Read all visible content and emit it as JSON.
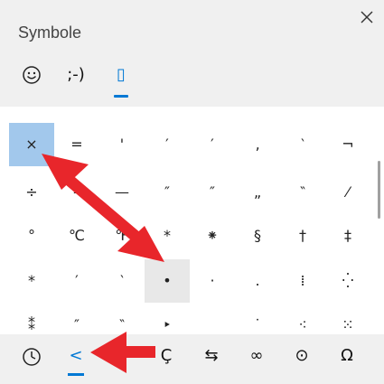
{
  "panel": {
    "title": "Symbole",
    "close_glyph": "✕"
  },
  "tabs": [
    {
      "label": "☺",
      "icon": "emoji-icon"
    },
    {
      "label": ";-)",
      "icon": "kaomoji-icon"
    },
    {
      "label": "▯",
      "icon": "symbols-icon",
      "active": true
    }
  ],
  "grid": {
    "partial_top_row": [
      "(",
      "",
      ""
    ],
    "rows": [
      [
        "×",
        "=",
        "'",
        "′",
        "′",
        "‚",
        "‵",
        "¬"
      ],
      [
        "÷",
        "–",
        "—",
        "″",
        "″",
        "„",
        "‶",
        "⁄"
      ],
      [
        "°",
        "℃",
        "℉",
        "*",
        "⁕",
        "§",
        "†",
        "‡"
      ],
      [
        "*",
        "′",
        "‵",
        "•",
        "·",
        ".",
        "⁞",
        "⁛"
      ],
      [
        "⁑",
        "″",
        "‶",
        "‣",
        "",
        "˙",
        "⁖",
        "⁙"
      ]
    ],
    "selected": "×",
    "hovered": "•"
  },
  "bottom_tabs": [
    {
      "label": "🕓",
      "icon": "recent-icon"
    },
    {
      "label": "<",
      "icon": "punctuation-icon",
      "active": true
    },
    {
      "label": "$",
      "icon": "currency-icon"
    },
    {
      "label": "Ç",
      "icon": "latin-icon"
    },
    {
      "label": "⇆",
      "icon": "arrows-icon"
    },
    {
      "label": "∞",
      "icon": "math-icon"
    },
    {
      "label": "⊙",
      "icon": "geometric-icon"
    },
    {
      "label": "Ω",
      "icon": "language-icon"
    }
  ],
  "colors": {
    "accent": "#0078d4",
    "selected": "#a2c8ec",
    "hover": "#e8e8e8",
    "arrow": "#e8262b"
  }
}
